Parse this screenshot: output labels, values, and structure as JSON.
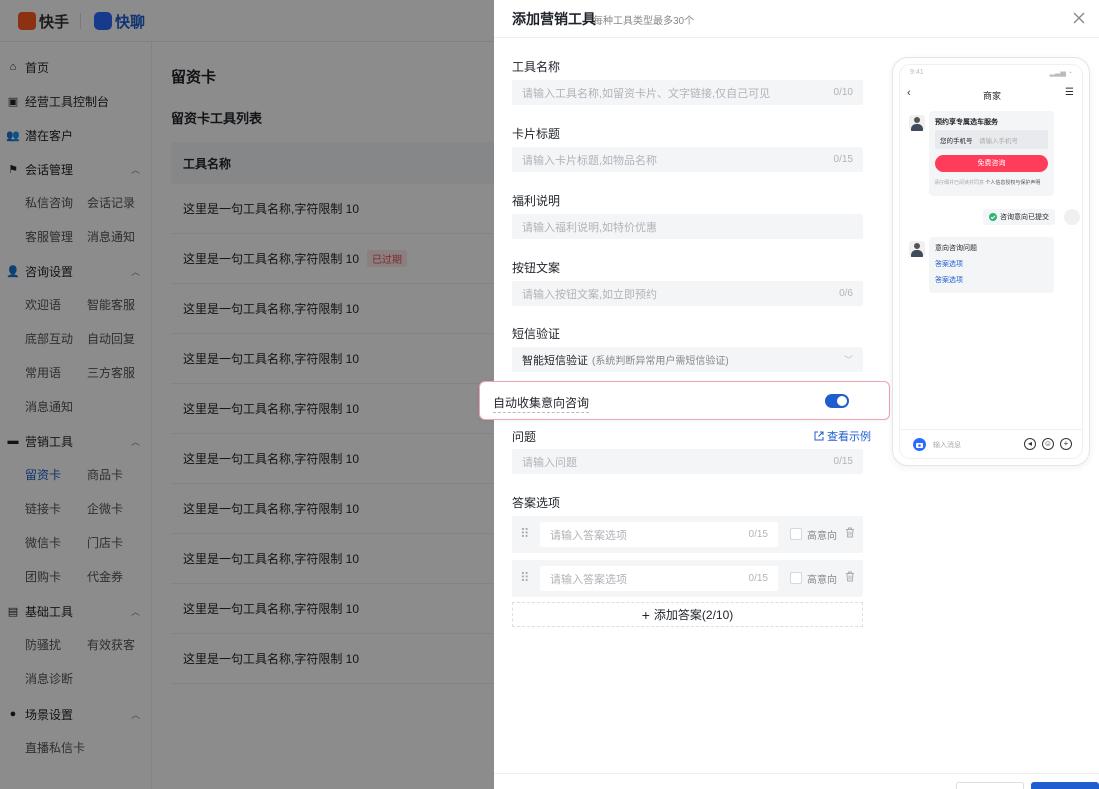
{
  "brand": {
    "logo_1": "快手",
    "logo_2": "快聊"
  },
  "sidebar": {
    "groups": [
      {
        "label": "首页",
        "icon": "home-icon"
      },
      {
        "label": "经营工具控制台",
        "icon": "dashboard-icon"
      },
      {
        "label": "潜在客户",
        "icon": "users-icon"
      },
      {
        "label": "会话管理",
        "icon": "flag-icon"
      },
      {
        "label": "咨询设置",
        "icon": "user-settings-icon"
      },
      {
        "label": "营销工具",
        "icon": "folder-icon"
      },
      {
        "label": "基础工具",
        "icon": "briefcase-icon"
      },
      {
        "label": "场景设置",
        "icon": "settings-icon"
      }
    ],
    "sub": {
      "chat_1": "私信咨询",
      "chat_2": "会话记录",
      "chat_3": "客服管理",
      "chat_4": "消息通知",
      "consult_1": "欢迎语",
      "consult_2": "智能客服",
      "consult_3": "底部互动",
      "consult_4": "自动回复",
      "consult_5": "常用语",
      "consult_6": "三方客服",
      "consult_7": "消息通知",
      "mkt_1": "留资卡",
      "mkt_2": "商品卡",
      "mkt_3": "链接卡",
      "mkt_4": "企微卡",
      "mkt_5": "微信卡",
      "mkt_6": "门店卡",
      "mkt_7": "团购卡",
      "mkt_8": "代金券",
      "basic_1": "防骚扰",
      "basic_2": "有效获客",
      "basic_3": "消息诊断",
      "scene_1": "直播私信卡"
    }
  },
  "main": {
    "page_title": "留资卡",
    "list_title": "留资卡工具列表",
    "table_header": "工具名称",
    "rows": [
      "这里是一句工具名称,字符限制 10",
      "这里是一句工具名称,字符限制 10",
      "这里是一句工具名称,字符限制 10",
      "这里是一句工具名称,字符限制 10",
      "这里是一句工具名称,字符限制 10",
      "这里是一句工具名称,字符限制 10",
      "这里是一句工具名称,字符限制 10",
      "这里是一句工具名称,字符限制 10",
      "这里是一句工具名称,字符限制 10",
      "这里是一句工具名称,字符限制 10"
    ],
    "expired_badge": "已过期"
  },
  "drawer": {
    "title": "添加营销工具",
    "subtitle": "每种工具类型最多30个",
    "fields": {
      "tool_name": {
        "label": "工具名称",
        "placeholder": "请输入工具名称,如留资卡片、文字链接,仅自己可见",
        "count": "0/10"
      },
      "card_title": {
        "label": "卡片标题",
        "placeholder": "请输入卡片标题,如物品名称",
        "count": "0/15"
      },
      "benefit": {
        "label": "福利说明",
        "placeholder": "请输入福利说明,如特价优惠"
      },
      "button_text": {
        "label": "按钮文案",
        "placeholder": "请输入按钮文案,如立即预约",
        "count": "0/6"
      },
      "sms": {
        "label": "短信验证",
        "value": "智能短信验证",
        "note": "(系统判断异常用户需短信验证)"
      }
    },
    "auto_collect": {
      "label": "自动收集意向咨询",
      "on": true
    },
    "question": {
      "label": "问题",
      "placeholder": "请输入问题",
      "count": "0/15",
      "view_example": "查看示例"
    },
    "answers": {
      "label": "答案选项",
      "items": [
        {
          "placeholder": "请输入答案选项",
          "count": "0/15",
          "check_label": "高意向"
        },
        {
          "placeholder": "请输入答案选项",
          "count": "0/15",
          "check_label": "高意向"
        }
      ],
      "add_label": "添加答案(2/10)"
    }
  },
  "preview": {
    "title": "商家",
    "status_time": "9:41",
    "card_title": "预约享专属选车服务",
    "phone_label": "您的手机号",
    "phone_placeholder": "请输入手机号",
    "consult_button": "免费咨询",
    "consent_text": "请仔细并已阅读并同意",
    "consent_link": "个人信息授权与保护声明",
    "submitted_text": "咨询意向已提交",
    "question_title": "意向咨询问题",
    "option_1": "答案选项",
    "option_2": "答案选项",
    "input_placeholder": "输入消息"
  },
  "colors": {
    "accent": "#1f5ecf",
    "danger": "#ff3d5a",
    "highlight_border": "#f2a3b0"
  }
}
